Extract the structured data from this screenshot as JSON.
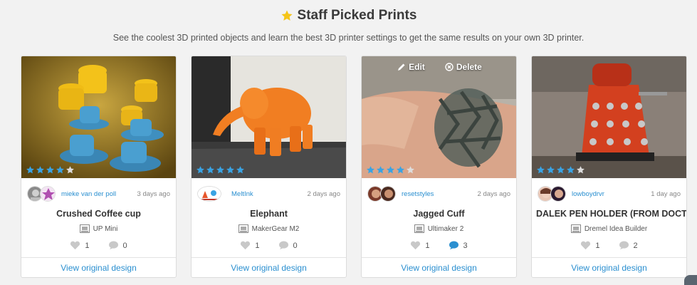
{
  "header": {
    "title": "Staff Picked Prints",
    "subtitle": "See the coolest 3D printed objects and learn the best 3D printer settings to get the same results on your own 3D printer."
  },
  "colors": {
    "accent_blue": "#2a8fd0",
    "star_blue": "#3aa3e3",
    "star_grey": "#dddddd",
    "title_star": "#f5c518"
  },
  "overlay": {
    "edit_label": "Edit",
    "delete_label": "Delete"
  },
  "cards": [
    {
      "username": "mieke van der poll",
      "time": "3 days ago",
      "name": "Crushed Coffee cup",
      "printer": "UP Mini",
      "likes": "1",
      "comments": "0",
      "rating": 4,
      "link": "View original design"
    },
    {
      "username": "MeltInk",
      "time": "2 days ago",
      "name": "Elephant",
      "printer": "MakerGear M2",
      "likes": "1",
      "comments": "0",
      "rating": 5,
      "link": "View original design"
    },
    {
      "username": "resetstyles",
      "time": "2 days ago",
      "name": "Jagged Cuff",
      "printer": "Ultimaker 2",
      "likes": "1",
      "comments": "3",
      "rating": 4,
      "link": "View original design"
    },
    {
      "username": "lowboydrvr",
      "time": "1 day ago",
      "name": "DALEK PEN HOLDER (FROM DOCT...",
      "printer": "Dremel Idea Builder",
      "likes": "1",
      "comments": "2",
      "rating": 4,
      "link": "View original design"
    }
  ]
}
